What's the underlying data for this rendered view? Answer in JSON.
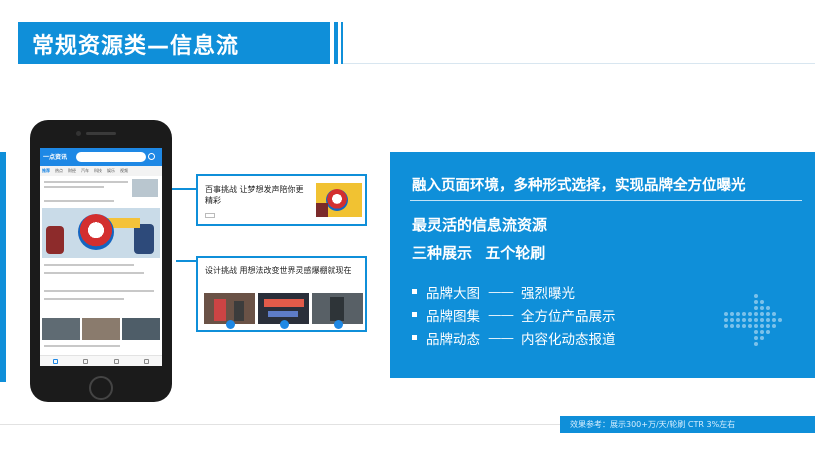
{
  "slide": {
    "title": "常规资源类—信息流"
  },
  "phone_app": {
    "logo_text": "一点资讯",
    "tabs": [
      "推荐",
      "热点",
      "财经",
      "汽车",
      "科技",
      "娱乐",
      "视频"
    ],
    "active_tab": 0
  },
  "cards": [
    {
      "text": "百事挑战 让梦想发声陪你更精彩"
    },
    {
      "text": "设计挑战 用想法改变世界灵感爆棚就现在"
    }
  ],
  "panel": {
    "headline": "融入页面环境，多种形式选择，实现品牌全方位曝光",
    "subtitle": "最灵活的信息流资源",
    "subtitle2": "三种展示   五个轮刷",
    "bullets": [
      {
        "name": "品牌大图",
        "dash": "——",
        "desc": "强烈曝光"
      },
      {
        "name": "品牌图集",
        "dash": "——",
        "desc": "全方位产品展示"
      },
      {
        "name": "品牌动态",
        "dash": "——",
        "desc": "内容化动态报道"
      }
    ]
  },
  "footer": {
    "note": "效果参考：展示300+万/天/轮刷 CTR 3%左右"
  },
  "colors": {
    "brand_blue": "#0f8fd9",
    "app_blue": "#1e88e5"
  }
}
